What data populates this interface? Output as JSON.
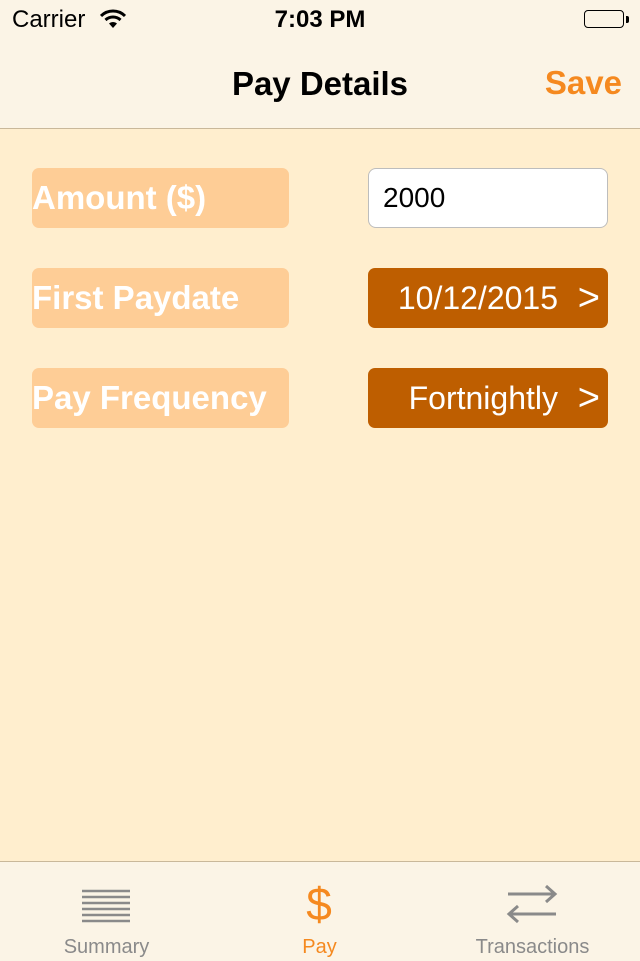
{
  "status_bar": {
    "carrier": "Carrier",
    "time": "7:03 PM",
    "icons": [
      "wifi-icon",
      "battery-icon"
    ]
  },
  "nav": {
    "title": "Pay Details",
    "save_label": "Save"
  },
  "form": {
    "amount_label": "Amount ($)",
    "amount_value": "2000",
    "first_paydate_label": "First Paydate",
    "first_paydate_value": "10/12/2015",
    "frequency_label": "Pay Frequency",
    "frequency_value": "Fortnightly",
    "chevron": ">"
  },
  "tabbar": {
    "tabs": [
      {
        "label": "Summary",
        "icon": "list-lines-icon",
        "active": false
      },
      {
        "label": "Pay",
        "icon": "dollar-icon",
        "active": true
      },
      {
        "label": "Transactions",
        "icon": "transfer-arrows-icon",
        "active": false
      }
    ]
  },
  "colors": {
    "background": "#FFEECE",
    "bars": "#FBF4E6",
    "label_bg": "#FECD96",
    "picker_bg": "#BE5E00",
    "accent": "#F5891F",
    "inactive": "#8A8A8A"
  }
}
